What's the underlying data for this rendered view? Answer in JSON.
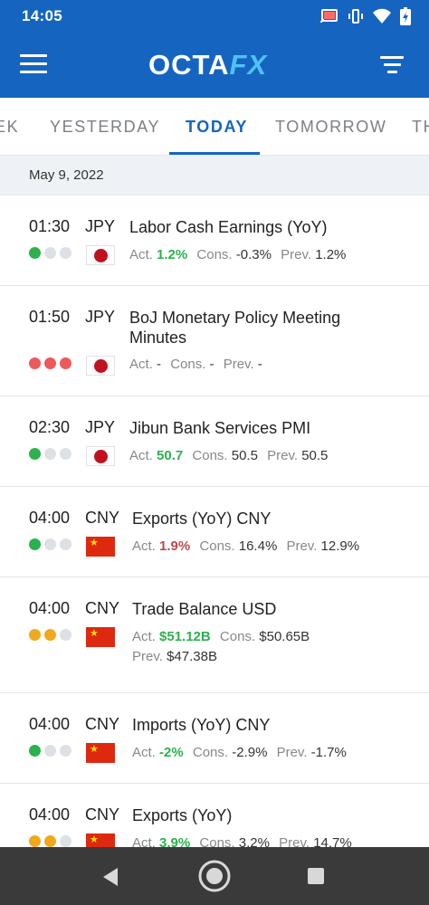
{
  "status_bar": {
    "time": "14:05",
    "icons": [
      "cast-icon",
      "vibrate-icon",
      "wifi-icon",
      "battery-icon"
    ]
  },
  "app_bar": {
    "logo_primary": "OCTA",
    "logo_secondary": "FX",
    "icons": [
      "menu-icon",
      "filter-icon"
    ]
  },
  "tabs": [
    {
      "label": "EK"
    },
    {
      "label": "YESTERDAY"
    },
    {
      "label": "TODAY",
      "active": true
    },
    {
      "label": "TOMORROW"
    },
    {
      "label": "TH"
    }
  ],
  "date_header": "May 9, 2022",
  "labels": {
    "actual": "Act.",
    "consensus": "Cons.",
    "previous": "Prev."
  },
  "importance_colors": {
    "low": "#2bb24c",
    "medium": "#f2a81d",
    "high": "#ec5a5a",
    "inactive": "#dde0e4"
  },
  "events": [
    {
      "time": "01:30",
      "currency": "JPY",
      "title": "Labor Cash Earnings (YoY)",
      "importance": 1,
      "level": "low",
      "flag": "jp",
      "actual": "1.2%",
      "actual_trend": "green",
      "consensus": "-0.3%",
      "previous": "1.2%"
    },
    {
      "time": "01:50",
      "currency": "JPY",
      "title": "BoJ Monetary Policy Meeting Minutes",
      "importance": 3,
      "level": "high",
      "flag": "jp",
      "actual": "-",
      "actual_trend": "neutral",
      "consensus": "-",
      "previous": "-"
    },
    {
      "time": "02:30",
      "currency": "JPY",
      "title": "Jibun Bank Services PMI",
      "importance": 1,
      "level": "low",
      "flag": "jp",
      "actual": "50.7",
      "actual_trend": "green",
      "consensus": "50.5",
      "previous": "50.5"
    },
    {
      "time": "04:00",
      "currency": "CNY",
      "title": "Exports (YoY) CNY",
      "importance": 1,
      "level": "low",
      "flag": "cn",
      "actual": "1.9%",
      "actual_trend": "red",
      "consensus": "16.4%",
      "previous": "12.9%"
    },
    {
      "time": "04:00",
      "currency": "CNY",
      "title": "Trade Balance USD",
      "importance": 2,
      "level": "medium",
      "flag": "cn",
      "actual": "$51.12B",
      "actual_trend": "green",
      "consensus": "$50.65B",
      "previous": "$47.38B"
    },
    {
      "time": "04:00",
      "currency": "CNY",
      "title": "Imports (YoY) CNY",
      "importance": 1,
      "level": "low",
      "flag": "cn",
      "actual": "-2%",
      "actual_trend": "green",
      "consensus": "-2.9%",
      "previous": "-1.7%"
    },
    {
      "time": "04:00",
      "currency": "CNY",
      "title": "Exports (YoY)",
      "importance": 2,
      "level": "medium",
      "flag": "cn",
      "actual": "3.9%",
      "actual_trend": "green",
      "consensus": "3.2%",
      "previous": "14.7%"
    }
  ],
  "nav_bar": {
    "icons": [
      "back-icon",
      "home-icon",
      "recents-icon"
    ]
  }
}
